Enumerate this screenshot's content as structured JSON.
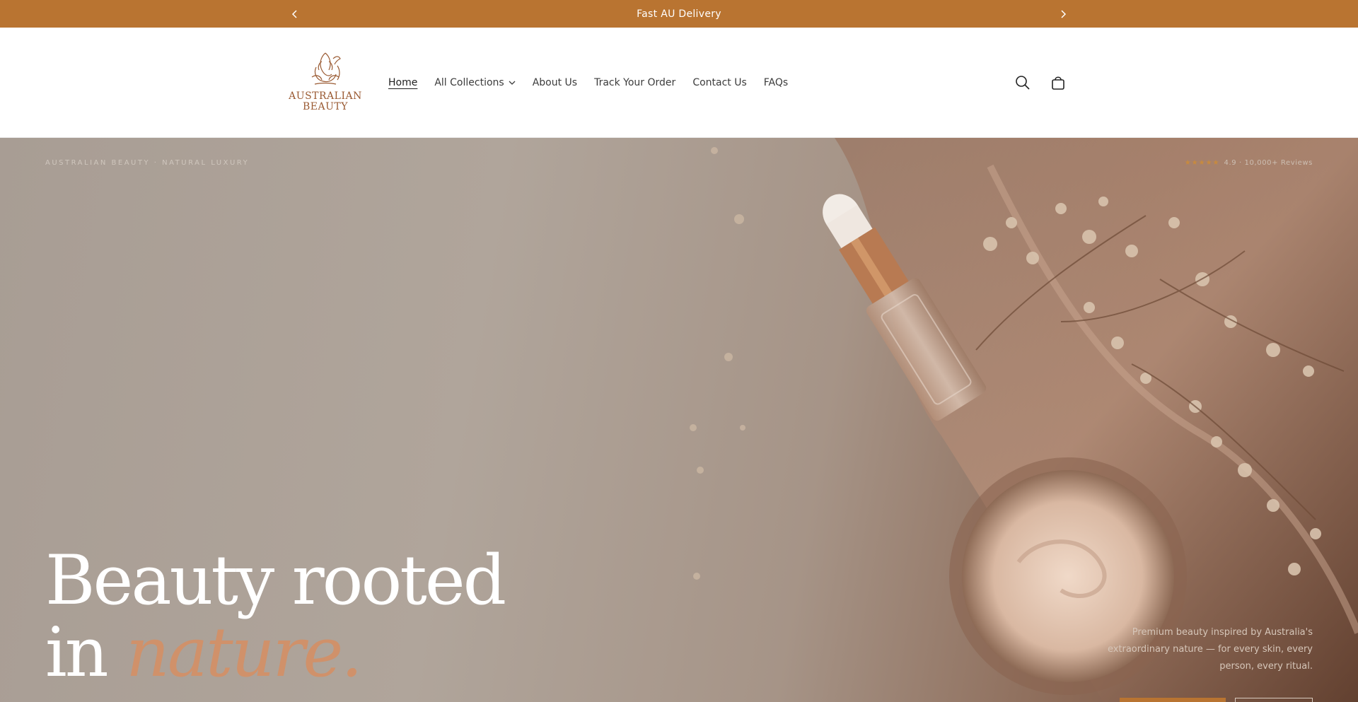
{
  "announcement": {
    "text": "Fast AU Delivery",
    "prev_icon": "chevron-left-icon",
    "next_icon": "chevron-right-icon"
  },
  "header": {
    "logo": {
      "line1": "AUSTRALIAN",
      "line2": "BEAUTY"
    },
    "nav": [
      {
        "label": "Home",
        "active": true
      },
      {
        "label": "All Collections",
        "has_dropdown": true
      },
      {
        "label": "About Us"
      },
      {
        "label": "Track Your Order"
      },
      {
        "label": "Contact Us"
      },
      {
        "label": "FAQs"
      }
    ],
    "icons": [
      "search-icon",
      "cart-icon"
    ]
  },
  "hero": {
    "tagline": "AUSTRALIAN BEAUTY · NATURAL LUXURY",
    "rating": {
      "stars": "★★★★★",
      "text": "4.9 · 10,000+ Reviews"
    },
    "title_line1": "Beauty rooted",
    "title_in": "in",
    "title_accent": "nature.",
    "subtitle": "Premium beauty inspired by Australia's extraordinary nature — for every skin, every person, every ritual."
  },
  "colors": {
    "accent": "#b97431",
    "accent_text": "#d0916a",
    "logo": "#9a5a32"
  }
}
